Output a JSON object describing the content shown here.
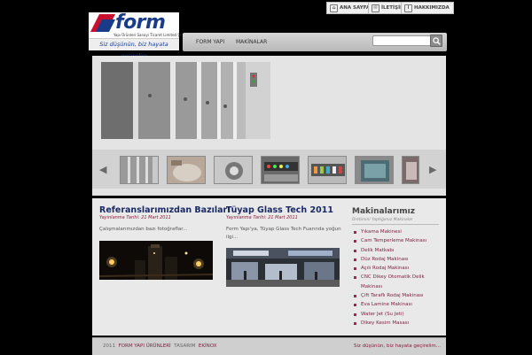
{
  "brand": {
    "logo_text": "form",
    "logo_subtext": "Yapı Ürünleri Sanayi Ticaret Limited Şirketi",
    "slogan": "Siz düşünün, biz hayata geçirelim"
  },
  "top_links": {
    "home": "ANA SAYFA",
    "contact": "İLETİŞİM",
    "about": "HAKKIMIZDA"
  },
  "nav": {
    "items": [
      "FORM YAPI",
      "MAKİNALAR"
    ],
    "search_placeholder": ""
  },
  "columns": [
    {
      "title": "Referanslarımızdan Bazıları",
      "date": "Yayınlanma Tarihi: 21 Mart 2011",
      "text": "Çalışmalarımızdan bazı fotoğraflar..."
    },
    {
      "title": "Tüyap Glass Tech 2011",
      "date": "Yayınlanma Tarihi: 21 Mart 2011",
      "text": "Form Yapı'ya, Tüyap Glass Tech Fuarında yoğun ilgi..."
    }
  ],
  "machines": {
    "title": "Makinalarımız",
    "subtitle": "Üretimini Yaptığımız Makinalar",
    "items": [
      "Yıkama Makinesi",
      "Cam Temperleme Makinası",
      "Delik Matkabı",
      "Düz Rodaj Makinası",
      "Açılı Rodaj Makinası",
      "CNC Dikey Otomatik Delik Makinası",
      "Çift Taraflı Rodaj Makinası",
      "Eva Lamine Makinası",
      "Water Jet (Su Jeti)",
      "Dikey Kesim Masası"
    ]
  },
  "footer": {
    "year": "2011",
    "company": "FORM YAPI ÜRÜNLERİ",
    "design_label": "TASARIM",
    "designer": "EKİNOX",
    "slogan": "Siz düşünün, biz hayata geçirelim..."
  },
  "colors": {
    "brand_blue": "#1a3b8a",
    "brand_red": "#c8102e",
    "link": "#7a1e3c"
  }
}
